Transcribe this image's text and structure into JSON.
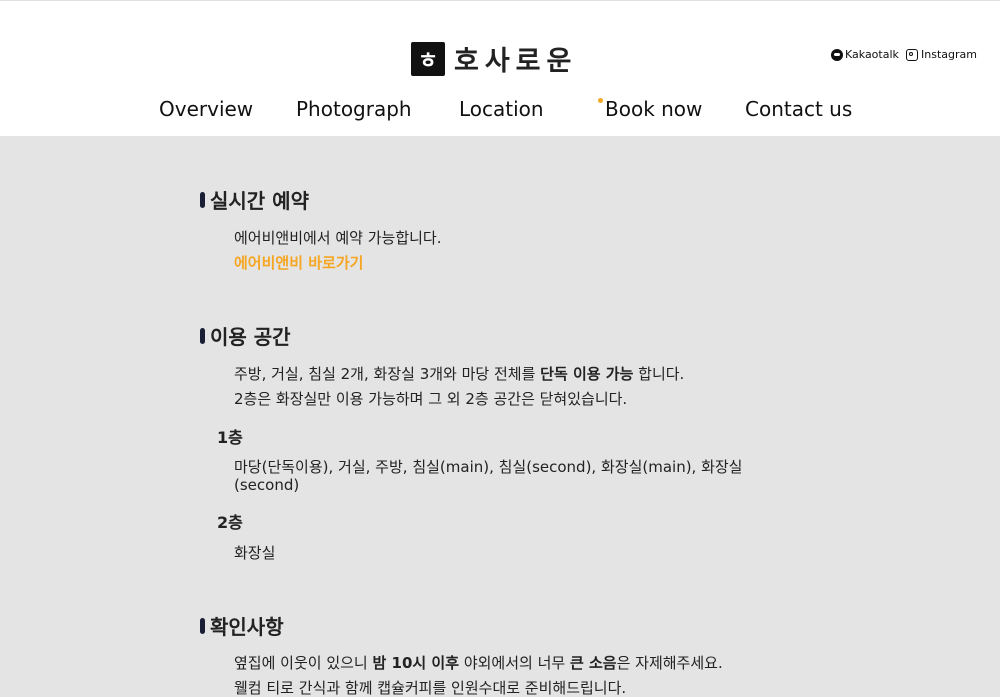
{
  "header": {
    "logo_mark": "ㅎ",
    "logo_text": "호사로운",
    "social": {
      "kakao": "Kakaotalk",
      "instagram": "Instagram"
    },
    "nav": [
      "Overview",
      "Photograph",
      "Location",
      "Book now",
      "Contact us"
    ]
  },
  "reservation": {
    "title": "실시간 예약",
    "desc": "에어비앤비에서 예약 가능합니다.",
    "link": "에어비앤비 바로가기"
  },
  "space": {
    "title": "이용 공간",
    "line1_pre": "주방, 거실, 침실 2개, 화장실 3개와 마당 전체를 ",
    "line1_bold": "단독 이용 가능",
    "line1_post": " 합니다.",
    "line2": "2층은 화장실만 이용 가능하며 그 외 2층 공간은 닫혀있습니다.",
    "floor1_label": "1층",
    "floor1_desc": "마당(단독이용), 거실, 주방, 침실(main), 침실(second), 화장실(main), 화장실 (second)",
    "floor2_label": "2층",
    "floor2_desc": "화장실"
  },
  "notice": {
    "title": "확인사항",
    "line1_a": "옆집에 이웃이 있으니 ",
    "line1_b": "밤 10시 이후",
    "line1_c": " 야외에서의 너무 ",
    "line1_d": "큰 소음",
    "line1_e": "은 자제해주세요.",
    "line2": "웰컴 티로 간식과 함께 캡슐커피를 인원수대로 준비해드립니다."
  },
  "colors": {
    "accent": "#f5a623",
    "bar": "#1a1f36",
    "background": "#e4e4e4"
  }
}
